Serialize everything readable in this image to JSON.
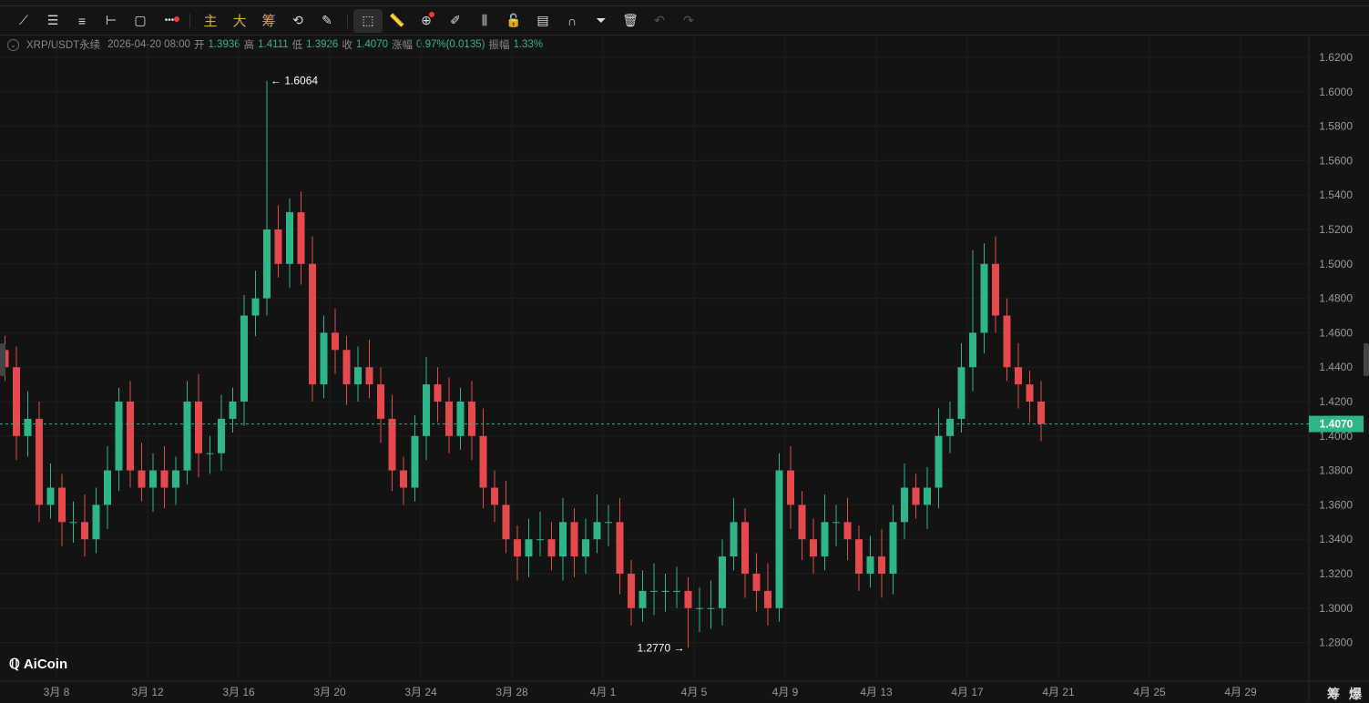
{
  "toolbar": {
    "items": [
      {
        "name": "trendline-icon",
        "glyph": "⟋"
      },
      {
        "name": "parallel-lines-icon",
        "glyph": "☰"
      },
      {
        "name": "horizontal-lines-icon",
        "glyph": "≡"
      },
      {
        "name": "horizontal-ray-icon",
        "glyph": "⊢"
      },
      {
        "name": "rectangle-icon",
        "glyph": "▢"
      },
      {
        "name": "more-icon",
        "glyph": "•••"
      }
    ],
    "indicators": [
      {
        "label": "主"
      },
      {
        "label": "大"
      },
      {
        "label": "筹"
      }
    ],
    "tools": [
      {
        "name": "sync-draw-icon",
        "glyph": "⟲"
      },
      {
        "name": "pen-magnet-icon",
        "glyph": "✎"
      },
      {
        "name": "select-icon",
        "glyph": "⬚"
      },
      {
        "name": "ruler-icon",
        "glyph": "📏"
      },
      {
        "name": "zoom-icon",
        "glyph": "⊕"
      },
      {
        "name": "brush-icon",
        "glyph": "✐"
      },
      {
        "name": "candles-icon",
        "glyph": "⫼"
      },
      {
        "name": "lock-icon",
        "glyph": "🔓"
      },
      {
        "name": "notes-icon",
        "glyph": "▤"
      },
      {
        "name": "magnet-icon",
        "glyph": "∩"
      },
      {
        "name": "filter-icon",
        "glyph": "⏷"
      },
      {
        "name": "trash-icon",
        "glyph": "🗑"
      },
      {
        "name": "undo-icon",
        "glyph": "↶"
      },
      {
        "name": "redo-icon",
        "glyph": "↷"
      }
    ]
  },
  "info": {
    "symbol": "XRP/USDT永续",
    "datetime": "2026-04-20 08:00",
    "open_label": "开",
    "open": "1.3936",
    "high_label": "高",
    "high": "1.4111",
    "low_label": "低",
    "low": "1.3926",
    "close_label": "收",
    "close": "1.4070",
    "change_label": "涨幅",
    "change": "0.97%(0.0135)",
    "amp_label": "振幅",
    "amp": "1.33%"
  },
  "brand": "AiCoin",
  "bottom_buttons": [
    "筹",
    "爆"
  ],
  "colors": {
    "up": "#2fb58a",
    "down": "#e5484d",
    "bg": "#131313"
  },
  "chart_data": {
    "type": "candlestick",
    "interval_days": 0.5,
    "start_day_of_march": 5.5,
    "closes": [
      1.44,
      1.4,
      1.41,
      1.36,
      1.37,
      1.35,
      1.35,
      1.34,
      1.36,
      1.38,
      1.42,
      1.38,
      1.37,
      1.38,
      1.37,
      1.38,
      1.42,
      1.39,
      1.39,
      1.41,
      1.42,
      1.47,
      1.48,
      1.52,
      1.5,
      1.53,
      1.5,
      1.43,
      1.46,
      1.45,
      1.43,
      1.44,
      1.43,
      1.41,
      1.38,
      1.37,
      1.4,
      1.43,
      1.42,
      1.4,
      1.42,
      1.4,
      1.37,
      1.36,
      1.34,
      1.33,
      1.34,
      1.34,
      1.33,
      1.35,
      1.33,
      1.34,
      1.35,
      1.35,
      1.32,
      1.3,
      1.31,
      1.31,
      1.31,
      1.31,
      1.3,
      1.3,
      1.3,
      1.33,
      1.35,
      1.32,
      1.31,
      1.3,
      1.38,
      1.36,
      1.34,
      1.33,
      1.35,
      1.35,
      1.34,
      1.32,
      1.33,
      1.32,
      1.35,
      1.37,
      1.36,
      1.37,
      1.4,
      1.41,
      1.44,
      1.46,
      1.5,
      1.47,
      1.44,
      1.43,
      1.42,
      1.407
    ],
    "y_ticks": [
      "1.6200",
      "1.6000",
      "1.5800",
      "1.5600",
      "1.5400",
      "1.5200",
      "1.5000",
      "1.4800",
      "1.4600",
      "1.4400",
      "1.4200",
      "1.4000",
      "1.3800",
      "1.3600",
      "1.3400",
      "1.3200",
      "1.3000",
      "1.2800"
    ],
    "ylim": [
      1.28,
      1.62
    ],
    "x_ticks": [
      "3月 8",
      "3月 12",
      "3月 16",
      "3月 20",
      "3月 24",
      "3月 28",
      "4月 1",
      "4月 5",
      "4月 9",
      "4月 13",
      "4月 17",
      "4月 21",
      "4月 25",
      "4月 29"
    ],
    "max_label": "1.6064",
    "max_value": 1.6064,
    "max_index": 23,
    "min_label": "1.2770",
    "min_value": 1.277,
    "min_index": 60,
    "peak2_value": 1.508,
    "peak2_index": 85,
    "last_price": "1.4070",
    "last_value": 1.407
  }
}
